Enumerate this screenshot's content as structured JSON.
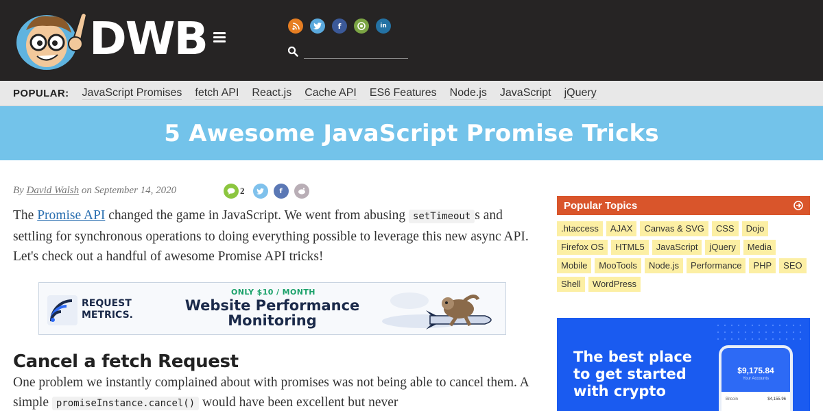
{
  "header": {
    "logo_text": "DWB",
    "search_placeholder": "",
    "social": [
      {
        "name": "rss",
        "glyph": "◎",
        "color": "#e67e22"
      },
      {
        "name": "twitter",
        "glyph": "🐦",
        "color": "#5aa9dd"
      },
      {
        "name": "facebook",
        "glyph": "f",
        "color": "#3b5998"
      },
      {
        "name": "github",
        "glyph": "◉",
        "color": "#7ba444"
      },
      {
        "name": "linkedin",
        "glyph": "in",
        "color": "#2472a4"
      }
    ]
  },
  "popular": {
    "label": "POPULAR:",
    "links": [
      "JavaScript Promises",
      "fetch API",
      "React.js",
      "Cache API",
      "ES6 Features",
      "Node.js",
      "JavaScript",
      "jQuery"
    ]
  },
  "article": {
    "title": "5 Awesome JavaScript Promise Tricks",
    "byline_prefix": "By",
    "author": "David Walsh",
    "date_prefix": "on",
    "date": "September 14, 2020",
    "comment_count": "2",
    "intro": {
      "before_link": "The ",
      "link": "Promise API",
      "after_link": " changed the game in JavaScript. We went from abusing ",
      "code": "setTimeout",
      "after_code": "s and settling for synchronous operations to doing everything possible to leverage this new async API. Let's check out a handful of awesome Promise API tricks!"
    },
    "section_heading": "Cancel a fetch Request",
    "section_text": {
      "before_code": "One problem we instantly complained about with promises was not being able to cancel them. A simple ",
      "code": "promiseInstance.cancel()",
      "after_code": " would have been excellent but never"
    }
  },
  "ad": {
    "brand_line1": "REQUEST",
    "brand_line2": "METRICS.",
    "offer": "ONLY $10 / MONTH",
    "headline_line1": "Website Performance",
    "headline_line2": "Monitoring"
  },
  "sidebar": {
    "popular_topics_title": "Popular Topics",
    "tags": [
      ".htaccess",
      "AJAX",
      "Canvas & SVG",
      "CSS",
      "Dojo",
      "Firefox OS",
      "HTML5",
      "JavaScript",
      "jQuery",
      "Media",
      "Mobile",
      "MooTools",
      "Node.js",
      "Performance",
      "PHP",
      "SEO",
      "Shell",
      "WordPress"
    ],
    "crypto_ad": {
      "headline_line1": "The best place",
      "headline_line2": "to get started",
      "headline_line3": "with crypto",
      "balance": "$9,175.84",
      "balance_sub": "Your Accounts",
      "row_left": "Bitcoin",
      "row_right": "$4,155.96"
    }
  },
  "colors": {
    "header_bg": "#262424",
    "title_banner": "#73c3ea",
    "popular_topics_header": "#d9552b",
    "tag_bg": "#fcefa4",
    "crypto_bg": "#1a5bf0"
  }
}
